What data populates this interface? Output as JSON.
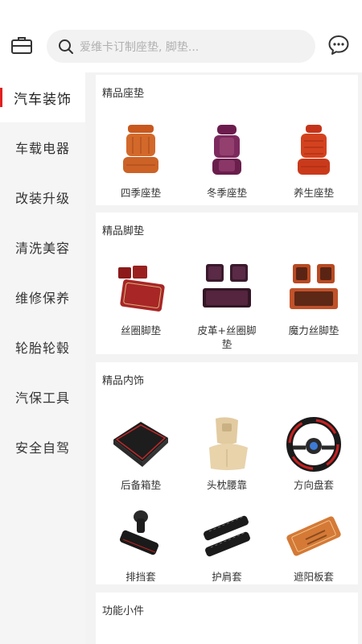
{
  "header": {
    "search_placeholder": "爱维卡订制座垫, 脚垫...",
    "left_icon": "toolbox-icon",
    "right_icon": "message-icon"
  },
  "sidebar": {
    "items": [
      {
        "label": "汽车装饰",
        "active": true
      },
      {
        "label": "车载电器",
        "active": false
      },
      {
        "label": "改装升级",
        "active": false
      },
      {
        "label": "清洗美容",
        "active": false
      },
      {
        "label": "维修保养",
        "active": false
      },
      {
        "label": "轮胎轮毂",
        "active": false
      },
      {
        "label": "汽保工具",
        "active": false
      },
      {
        "label": "安全自驾",
        "active": false
      }
    ]
  },
  "sections": [
    {
      "title": "精品座垫",
      "products": [
        {
          "label": "四季座垫",
          "icon": "seat-cushion-icon"
        },
        {
          "label": "冬季座垫",
          "icon": "seat-cushion-icon"
        },
        {
          "label": "养生座垫",
          "icon": "seat-cushion-icon"
        }
      ]
    },
    {
      "title": "精品脚垫",
      "products": [
        {
          "label": "丝圈脚垫",
          "icon": "floor-mat-icon"
        },
        {
          "label": "皮革+丝圈脚垫",
          "icon": "floor-mat-icon"
        },
        {
          "label": "魔力丝脚垫",
          "icon": "floor-mat-icon"
        }
      ]
    },
    {
      "title": "精品内饰",
      "products": [
        {
          "label": "后备箱垫",
          "icon": "trunk-mat-icon"
        },
        {
          "label": "头枕腰靠",
          "icon": "headrest-icon"
        },
        {
          "label": "方向盘套",
          "icon": "steering-wheel-icon"
        },
        {
          "label": "排挡套",
          "icon": "gear-shift-icon"
        },
        {
          "label": "护肩套",
          "icon": "shoulder-pad-icon"
        },
        {
          "label": "遮阳板套",
          "icon": "sun-visor-icon"
        }
      ]
    },
    {
      "title": "功能小件",
      "products": []
    }
  ],
  "colors": {
    "accent": "#e02020",
    "background": "#f3f3f3"
  }
}
